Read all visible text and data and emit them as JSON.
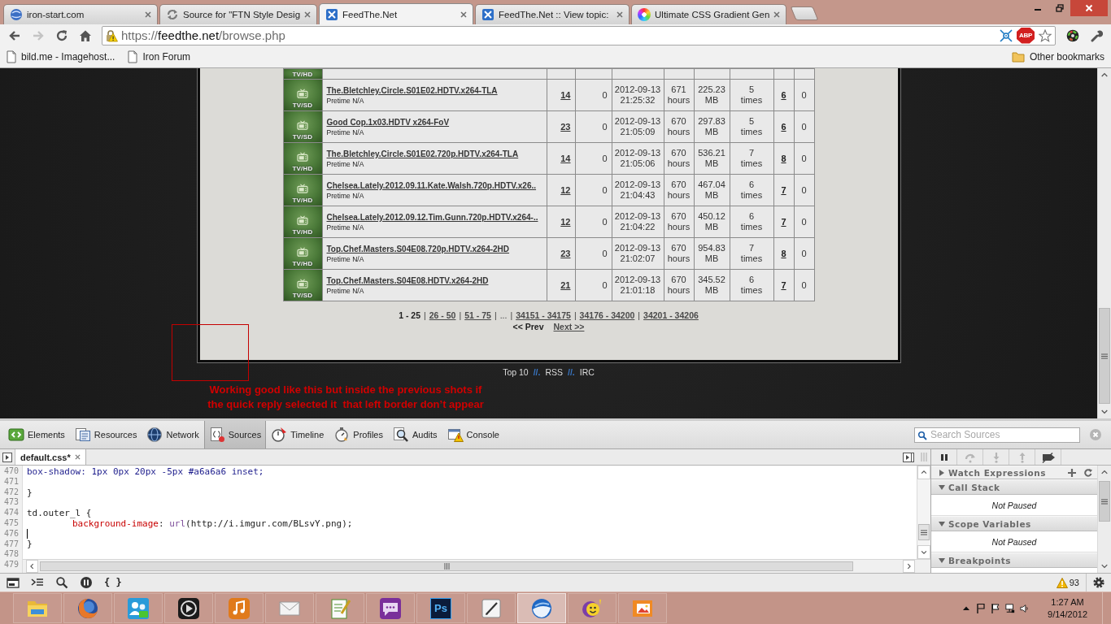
{
  "browser": {
    "tabs": [
      {
        "kind": "globe",
        "title": "iron-start.com",
        "selected": false
      },
      {
        "kind": "swirl",
        "title": "Source for \"FTN Style Desig",
        "selected": false
      },
      {
        "kind": "site",
        "title": "FeedThe.Net",
        "selected": true
      },
      {
        "kind": "site",
        "title": "FeedThe.Net :: View topic:",
        "selected": false
      },
      {
        "kind": "wheel",
        "title": "Ultimate CSS Gradient Gen",
        "selected": false
      }
    ],
    "nav": [
      {
        "kind": "back",
        "disabled": false
      },
      {
        "kind": "forward",
        "disabled": true
      },
      {
        "kind": "reload",
        "disabled": false
      },
      {
        "kind": "home",
        "disabled": false
      }
    ],
    "address": {
      "scheme": "https://",
      "host": "feedthe.net",
      "path": "/browse.php"
    },
    "extension_badge": "ABP",
    "bookmarks": [
      {
        "title": "bild.me - Imagehost..."
      },
      {
        "title": "Iron Forum"
      }
    ],
    "other_bookmarks": "Other bookmarks"
  },
  "page": {
    "partial_row": {
      "category": "TV/HD"
    },
    "torrents": [
      {
        "category": "TV/SD",
        "name": "The.Bletchley.Circle.S01E02.HDTV.x264-TLA",
        "pretime": "Pretime N/A",
        "files": "14",
        "comments": "0",
        "added_date": "2012-09-13",
        "added_time": "21:25:32",
        "ttl": "671 hours",
        "size": "225.23 MB",
        "snatched": "5 times",
        "seeders": "6",
        "leechers": "0"
      },
      {
        "category": "TV/SD",
        "name": "Good Cop.1x03.HDTV x264-FoV",
        "pretime": "Pretime N/A",
        "files": "23",
        "comments": "0",
        "added_date": "2012-09-13",
        "added_time": "21:05:09",
        "ttl": "670 hours",
        "size": "297.83 MB",
        "snatched": "5 times",
        "seeders": "6",
        "leechers": "0"
      },
      {
        "category": "TV/HD",
        "name": "The.Bletchley.Circle.S01E02.720p.HDTV.x264-TLA",
        "pretime": "Pretime N/A",
        "files": "14",
        "comments": "0",
        "added_date": "2012-09-13",
        "added_time": "21:05:06",
        "ttl": "670 hours",
        "size": "536.21 MB",
        "snatched": "7 times",
        "seeders": "8",
        "leechers": "0"
      },
      {
        "category": "TV/HD",
        "name": "Chelsea.Lately.2012.09.11.Kate.Walsh.720p.HDTV.x26..",
        "pretime": "Pretime N/A",
        "files": "12",
        "comments": "0",
        "added_date": "2012-09-13",
        "added_time": "21:04:43",
        "ttl": "670 hours",
        "size": "467.04 MB",
        "snatched": "6 times",
        "seeders": "7",
        "leechers": "0"
      },
      {
        "category": "TV/HD",
        "name": "Chelsea.Lately.2012.09.12.Tim.Gunn.720p.HDTV.x264-..",
        "pretime": "Pretime N/A",
        "files": "12",
        "comments": "0",
        "added_date": "2012-09-13",
        "added_time": "21:04:22",
        "ttl": "670 hours",
        "size": "450.12 MB",
        "snatched": "6 times",
        "seeders": "7",
        "leechers": "0"
      },
      {
        "category": "TV/HD",
        "name": "Top.Chef.Masters.S04E08.720p.HDTV.x264-2HD",
        "pretime": "Pretime N/A",
        "files": "23",
        "comments": "0",
        "added_date": "2012-09-13",
        "added_time": "21:02:07",
        "ttl": "670 hours",
        "size": "954.83 MB",
        "snatched": "7 times",
        "seeders": "8",
        "leechers": "0"
      },
      {
        "category": "TV/SD",
        "name": "Top.Chef.Masters.S04E08.HDTV.x264-2HD",
        "pretime": "Pretime N/A",
        "files": "21",
        "comments": "0",
        "added_date": "2012-09-13",
        "added_time": "21:01:18",
        "ttl": "670 hours",
        "size": "345.52 MB",
        "snatched": "6 times",
        "seeders": "7",
        "leechers": "0"
      }
    ],
    "pagination": {
      "pages": [
        {
          "kind": "page",
          "label": "1 - 25",
          "selected": true
        },
        {
          "kind": "page",
          "separator": "|",
          "label": "26 - 50",
          "selected": false
        },
        {
          "kind": "page",
          "separator": "|",
          "label": "51 - 75",
          "selected": false
        },
        {
          "kind": "ellipsis",
          "separator": "|",
          "label": "..."
        },
        {
          "kind": "page",
          "separator": "|",
          "label": "34151 - 34175",
          "selected": false
        },
        {
          "kind": "page",
          "separator": "|",
          "label": "34176 - 34200",
          "selected": false
        },
        {
          "kind": "page",
          "separator": "|",
          "label": "34201 - 34206",
          "selected": false
        }
      ],
      "prev": {
        "label": "<< Prev",
        "disabled": true
      },
      "next": {
        "label": "Next >>",
        "disabled": false
      }
    },
    "footer": [
      {
        "kind": "link",
        "text": "Top 10"
      },
      {
        "kind": "separator",
        "text": "//."
      },
      {
        "kind": "link",
        "text": "RSS"
      },
      {
        "kind": "separator",
        "text": "//."
      },
      {
        "kind": "link",
        "text": "IRC"
      }
    ]
  },
  "annotation": {
    "text": "Working good like this but inside the previous shots if\nthe quick reply selected it  that left border don’t appear"
  },
  "devtools": {
    "panels": [
      {
        "kind": "elements",
        "label": "Elements",
        "selected": false
      },
      {
        "kind": "resources",
        "label": "Resources",
        "selected": false
      },
      {
        "kind": "network",
        "label": "Network",
        "selected": false
      },
      {
        "kind": "sources",
        "label": "Sources",
        "selected": true
      },
      {
        "kind": "timeline",
        "label": "Timeline",
        "selected": false
      },
      {
        "kind": "profiles",
        "label": "Profiles",
        "selected": false
      },
      {
        "kind": "audits",
        "label": "Audits",
        "selected": false
      },
      {
        "kind": "console",
        "label": "Console",
        "selected": false
      }
    ],
    "search": {
      "placeholder": "Search Sources"
    },
    "open_files": [
      {
        "name": "default.css*",
        "selected": true
      }
    ],
    "code_lines": [
      {
        "number": "470",
        "indented": false,
        "caret": false,
        "tokens": [
          {
            "kind": "value",
            "text": "box-shadow: 1px 0px 20px -5px #a6a6a6 inset;"
          }
        ]
      },
      {
        "number": "471",
        "caret": false
      },
      {
        "number": "472",
        "indented": false,
        "caret": false,
        "tokens": [
          {
            "kind": "plain",
            "text": "}"
          }
        ]
      },
      {
        "number": "473",
        "caret": false
      },
      {
        "number": "474",
        "indented": false,
        "caret": false,
        "tokens": [
          {
            "kind": "plain",
            "text": "td.outer_l {"
          }
        ]
      },
      {
        "number": "475",
        "indented": true,
        "caret": false,
        "tokens": [
          {
            "kind": "property",
            "text": "background-image"
          },
          {
            "kind": "plain",
            "text": ": "
          },
          {
            "kind": "keyword",
            "text": "url"
          },
          {
            "kind": "plain",
            "text": "(http://i.imgur.com/BLsvY.png);"
          }
        ]
      },
      {
        "number": "476",
        "caret": true
      },
      {
        "number": "477",
        "indented": false,
        "caret": false,
        "tokens": [
          {
            "kind": "plain",
            "text": "}"
          }
        ]
      },
      {
        "number": "478",
        "caret": false
      },
      {
        "number": "479",
        "caret": false
      }
    ],
    "debugger_buttons": [
      {
        "kind": "pause",
        "disabled": false
      },
      {
        "kind": "step-over",
        "disabled": true
      },
      {
        "kind": "step-into",
        "disabled": true
      },
      {
        "kind": "step-out",
        "disabled": true
      },
      {
        "kind": "deactivate",
        "disabled": false
      }
    ],
    "sections": [
      {
        "kind": "watch",
        "title": "Watch Expressions",
        "expanded": false
      },
      {
        "kind": "pane",
        "title": "Call Stack",
        "expanded": true,
        "body": "Not Paused"
      },
      {
        "kind": "pane",
        "title": "Scope Variables",
        "expanded": true,
        "body": "Not Paused"
      },
      {
        "kind": "pane",
        "title": "Breakpoints",
        "expanded": true
      }
    ],
    "pretty_print_label": "{ }",
    "warnings": "93"
  },
  "taskbar": {
    "apps": [
      {
        "kind": "folder",
        "selected": false
      },
      {
        "kind": "foxglobe",
        "selected": false
      },
      {
        "kind": "people",
        "selected": false
      },
      {
        "kind": "play",
        "selected": false
      },
      {
        "kind": "music",
        "selected": false
      },
      {
        "kind": "mail",
        "selected": false
      },
      {
        "kind": "notepad",
        "selected": false
      },
      {
        "kind": "chat",
        "selected": false
      },
      {
        "kind": "logo",
        "label": "Ps",
        "selected": false
      },
      {
        "kind": "pen",
        "selected": false
      },
      {
        "kind": "sphere",
        "selected": true
      },
      {
        "kind": "smiley",
        "selected": false
      },
      {
        "kind": "photo",
        "selected": false
      }
    ],
    "clock": {
      "time": "1:27 AM",
      "date": "9/14/2012"
    }
  }
}
